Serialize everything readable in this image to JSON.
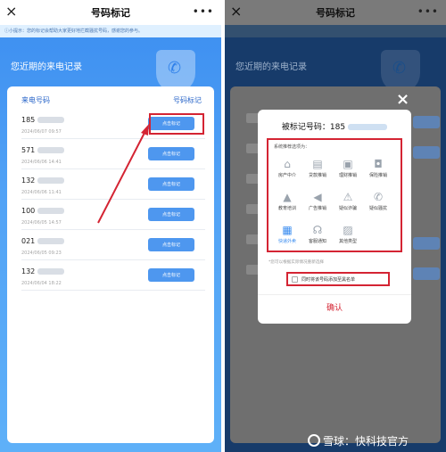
{
  "left": {
    "title": "号码标记",
    "close_icon": "×",
    "more_icon": "•••",
    "hint": "ⓘ小提示：您的标记会帮助大家更好地拦截骚扰号码，感谢您的参与。",
    "hero": "您近期的来电记录",
    "header_number": "来电号码",
    "header_mark": "号码标记",
    "mark_label": "点击标记",
    "rows": [
      {
        "number": "185",
        "date": "2024/06/07 09:57"
      },
      {
        "number": "571",
        "date": "2024/06/06 14:41"
      },
      {
        "number": "132",
        "date": "2024/06/06 11:41"
      },
      {
        "number": "100",
        "date": "2024/06/05 14:57"
      },
      {
        "number": "021",
        "date": "2024/06/05 09:23"
      },
      {
        "number": "132",
        "date": "2024/06/04 18:22"
      }
    ]
  },
  "right": {
    "title": "号码标记",
    "close_icon": "×",
    "more_icon": "•••",
    "hero": "您近期的来电记录",
    "dialog": {
      "close_icon": "×",
      "title": "被标记号码：",
      "number": "185",
      "types_title": "系统推荐选项为：",
      "types": [
        {
          "label": "房产中介",
          "icon": "house-icon",
          "glyph": "⌂"
        },
        {
          "label": "贷款推销",
          "icon": "card-icon",
          "glyph": "▤"
        },
        {
          "label": "理财推销",
          "icon": "briefcase-icon",
          "glyph": "▣"
        },
        {
          "label": "保险推销",
          "icon": "bag-icon",
          "glyph": "◘"
        },
        {
          "label": "教育培训",
          "icon": "graduation-cap-icon",
          "glyph": "▲"
        },
        {
          "label": "广告推销",
          "icon": "megaphone-icon",
          "glyph": "◀"
        },
        {
          "label": "疑似诈骗",
          "icon": "warning-icon",
          "glyph": "⚠"
        },
        {
          "label": "疑似骚扰",
          "icon": "phone-icon",
          "glyph": "✆"
        },
        {
          "label": "快递外卖",
          "icon": "package-icon",
          "glyph": "▦",
          "selected": true
        },
        {
          "label": "客服通知",
          "icon": "headset-icon",
          "glyph": "☊"
        },
        {
          "label": "其他类型",
          "icon": "other-icon",
          "glyph": "▨"
        }
      ],
      "note": "*您可以根据实际情况重新选择",
      "blacklist": "同时将该号码添加至黑名单",
      "confirm": "确认"
    }
  },
  "watermark": "雪球：快科技官方",
  "colors": {
    "accent": "#3b8df0",
    "highlight": "#d42433",
    "button": "#4e97ef"
  }
}
